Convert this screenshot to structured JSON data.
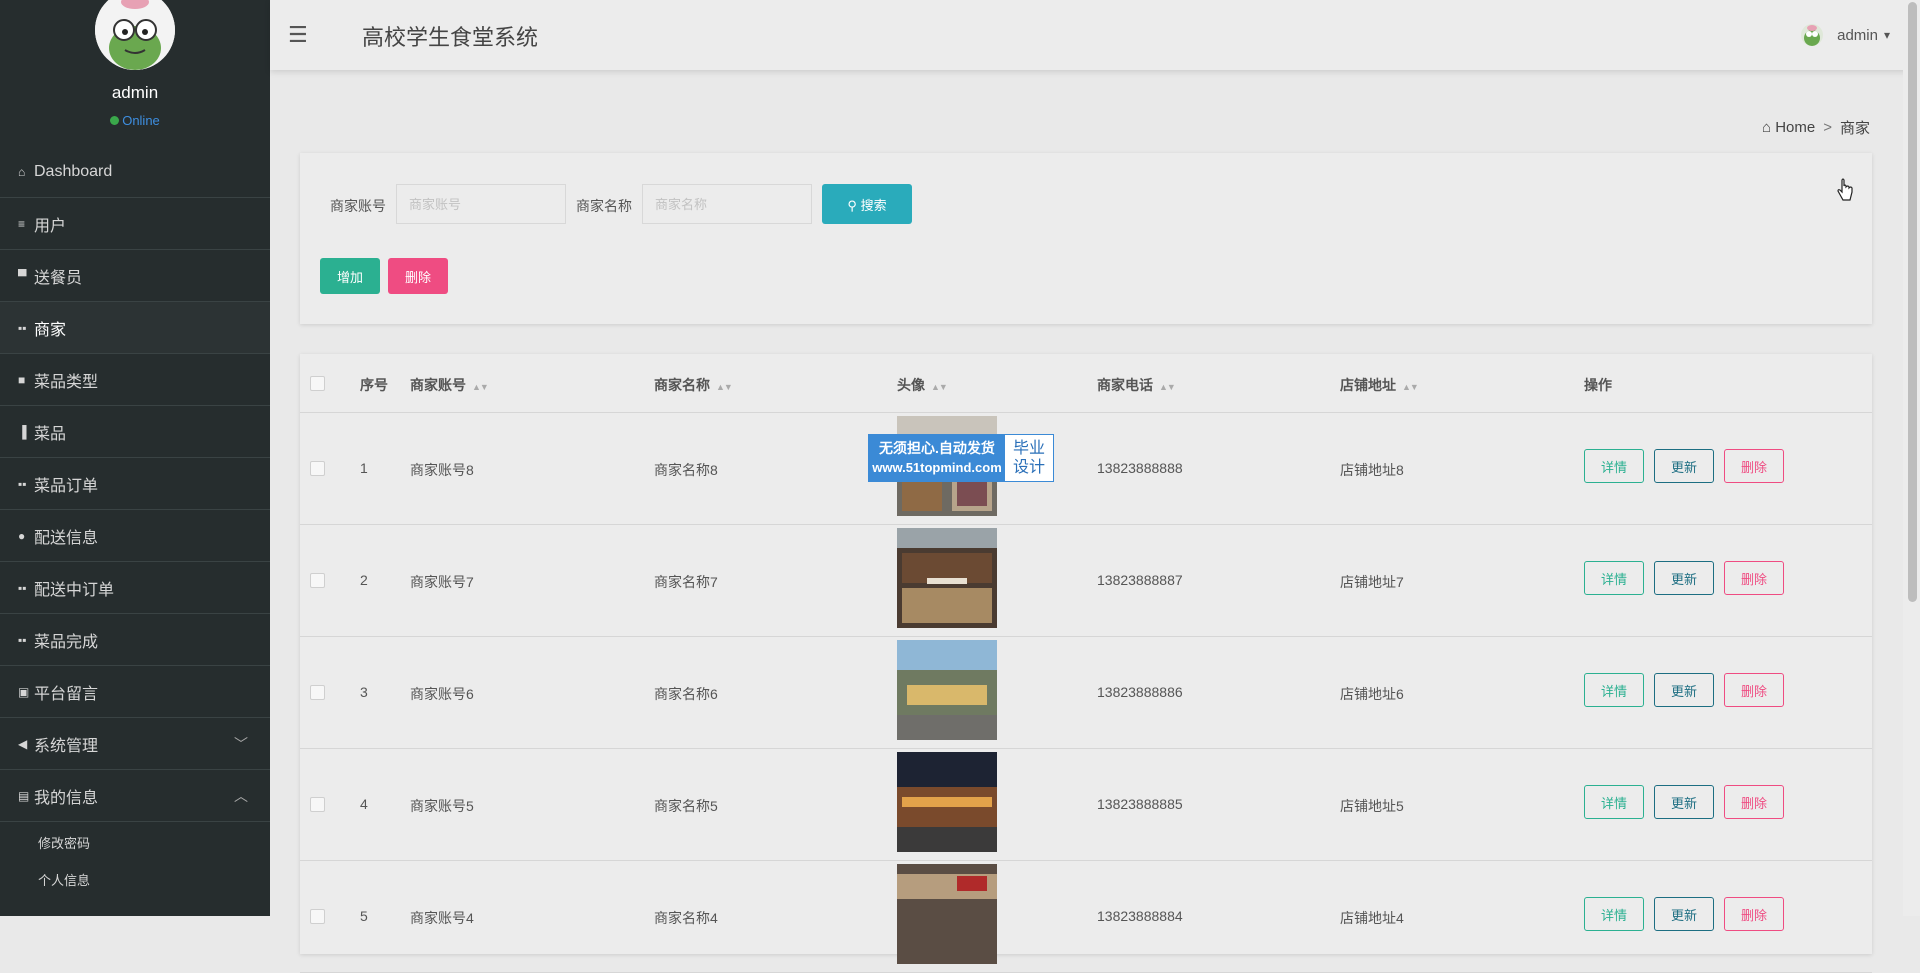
{
  "app": {
    "title": "高校学生食堂系统"
  },
  "user": {
    "name": "admin",
    "status": "Online"
  },
  "sidebar": {
    "items": [
      {
        "label": "Dashboard",
        "icon": "home-icon"
      },
      {
        "label": "用户",
        "icon": "list-icon"
      },
      {
        "label": "送餐员",
        "icon": "monitor-icon"
      },
      {
        "label": "商家",
        "icon": "grid-icon",
        "active": true
      },
      {
        "label": "菜品类型",
        "icon": "file-icon"
      },
      {
        "label": "菜品",
        "icon": "bar-chart-icon"
      },
      {
        "label": "菜品订单",
        "icon": "grid-icon"
      },
      {
        "label": "配送信息",
        "icon": "map-pin-icon"
      },
      {
        "label": "配送中订单",
        "icon": "grid-icon"
      },
      {
        "label": "菜品完成",
        "icon": "grid-icon"
      },
      {
        "label": "平台留言",
        "icon": "clipboard-icon"
      },
      {
        "label": "系统管理",
        "icon": "send-icon",
        "expandable": true
      },
      {
        "label": "我的信息",
        "icon": "card-icon",
        "expanded": true
      }
    ],
    "subitems": [
      {
        "label": "修改密码"
      },
      {
        "label": "个人信息"
      }
    ]
  },
  "header": {
    "user_label": "admin"
  },
  "breadcrumb": {
    "home": "Home",
    "separator": ">",
    "current": "商家"
  },
  "search": {
    "account_label": "商家账号",
    "account_placeholder": "商家账号",
    "name_label": "商家名称",
    "name_placeholder": "商家名称",
    "search_button": "搜索",
    "add_button": "增加",
    "delete_button": "删除"
  },
  "table": {
    "columns": [
      "序号",
      "商家账号",
      "商家名称",
      "头像",
      "商家电话",
      "店铺地址",
      "操作"
    ],
    "actions": {
      "detail": "详情",
      "update": "更新",
      "delete": "删除"
    },
    "rows": [
      {
        "index": "1",
        "account": "商家账号8",
        "name": "商家名称8",
        "phone": "13823888888",
        "address": "店铺地址8"
      },
      {
        "index": "2",
        "account": "商家账号7",
        "name": "商家名称7",
        "phone": "13823888887",
        "address": "店铺地址7"
      },
      {
        "index": "3",
        "account": "商家账号6",
        "name": "商家名称6",
        "phone": "13823888886",
        "address": "店铺地址6"
      },
      {
        "index": "4",
        "account": "商家账号5",
        "name": "商家名称5",
        "phone": "13823888885",
        "address": "店铺地址5"
      },
      {
        "index": "5",
        "account": "商家账号4",
        "name": "商家名称4",
        "phone": "13823888884",
        "address": "店铺地址4"
      }
    ]
  },
  "watermark": {
    "line1": "无须担心.自动发货",
    "url": "www.51topmind.com",
    "right1": "毕业",
    "right2": "设计"
  },
  "colors": {
    "sidebar_bg": "#262d2e",
    "primary": "#2aabbb",
    "success": "#2bb091",
    "danger": "#ef4c82",
    "update": "#1d6e82"
  }
}
